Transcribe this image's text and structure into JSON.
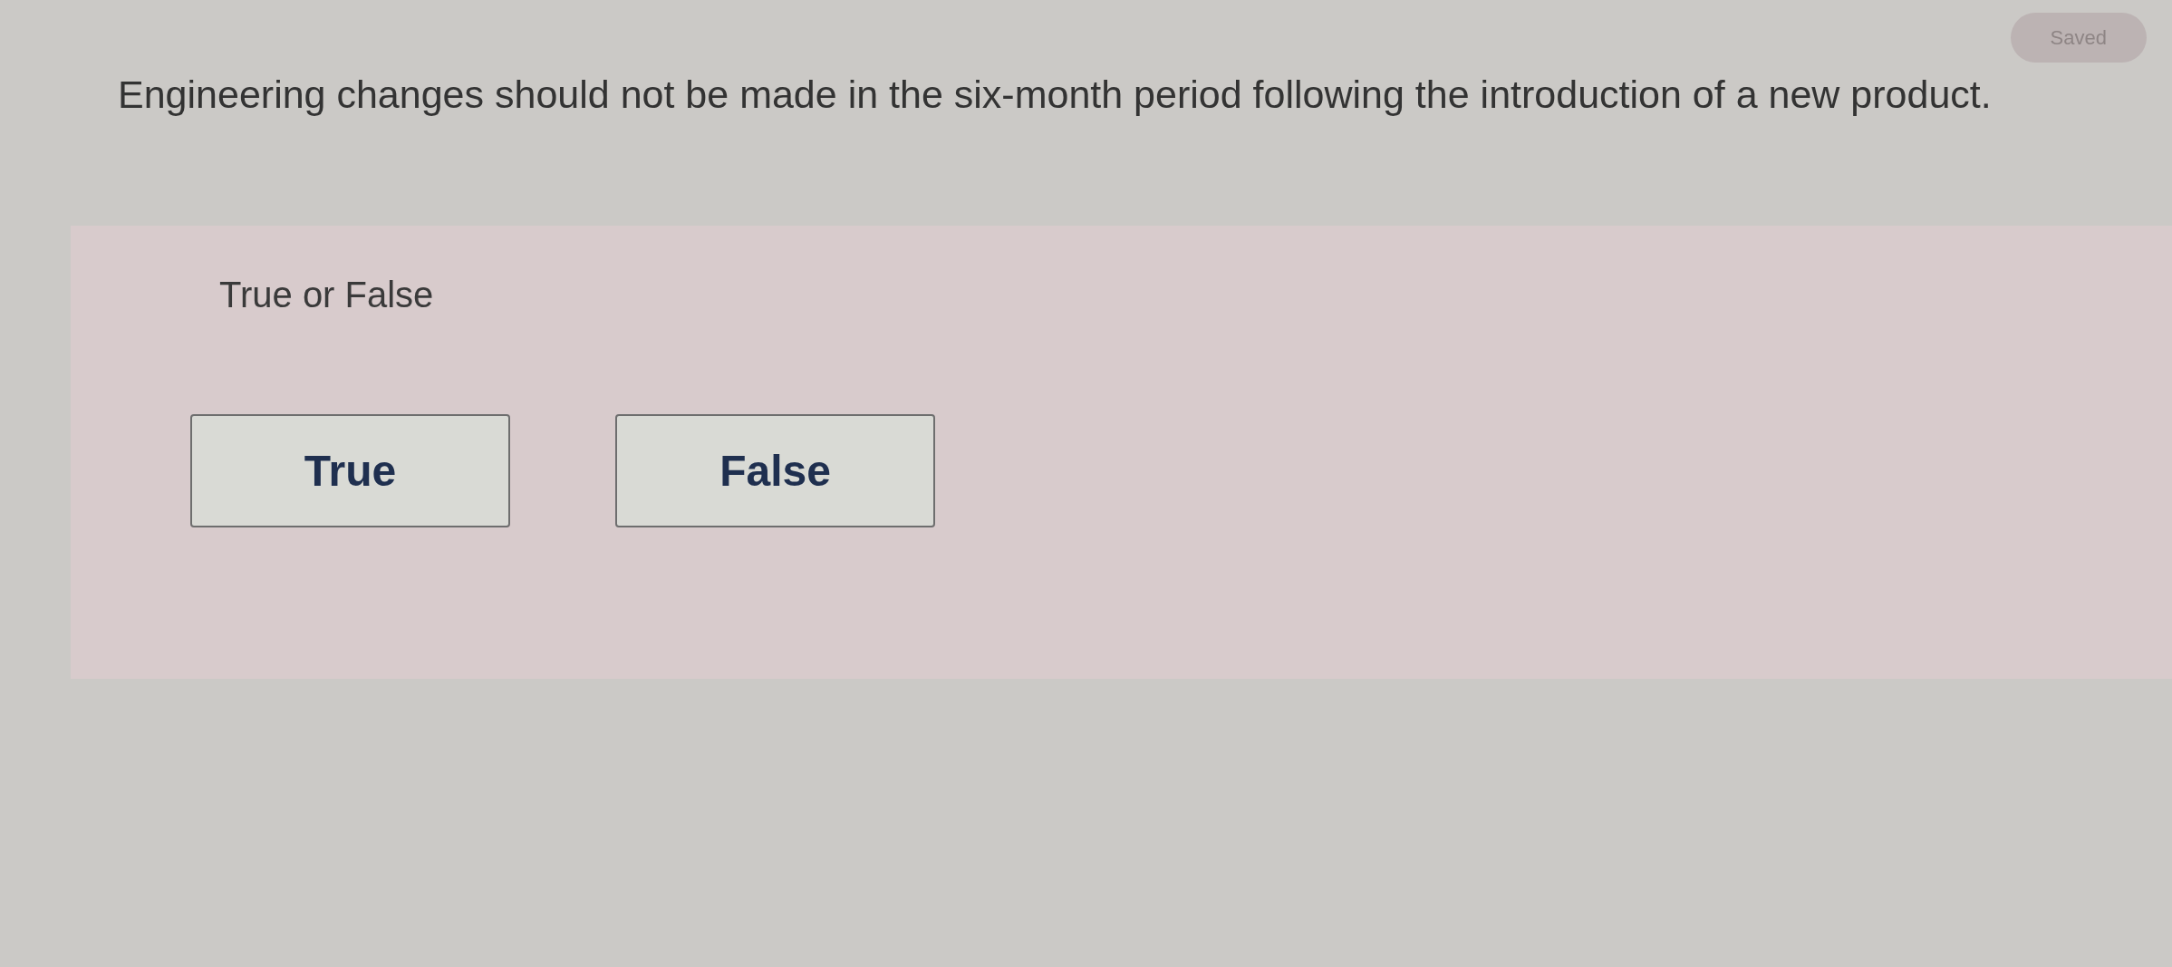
{
  "status_badge": {
    "label": "Saved"
  },
  "question": {
    "text": "Engineering changes should not be made in the six-month period following the introduction of a new product."
  },
  "answer_panel": {
    "prompt": "True or False",
    "options": [
      {
        "label": "True",
        "selected": false
      },
      {
        "label": "False",
        "selected": false
      }
    ]
  }
}
